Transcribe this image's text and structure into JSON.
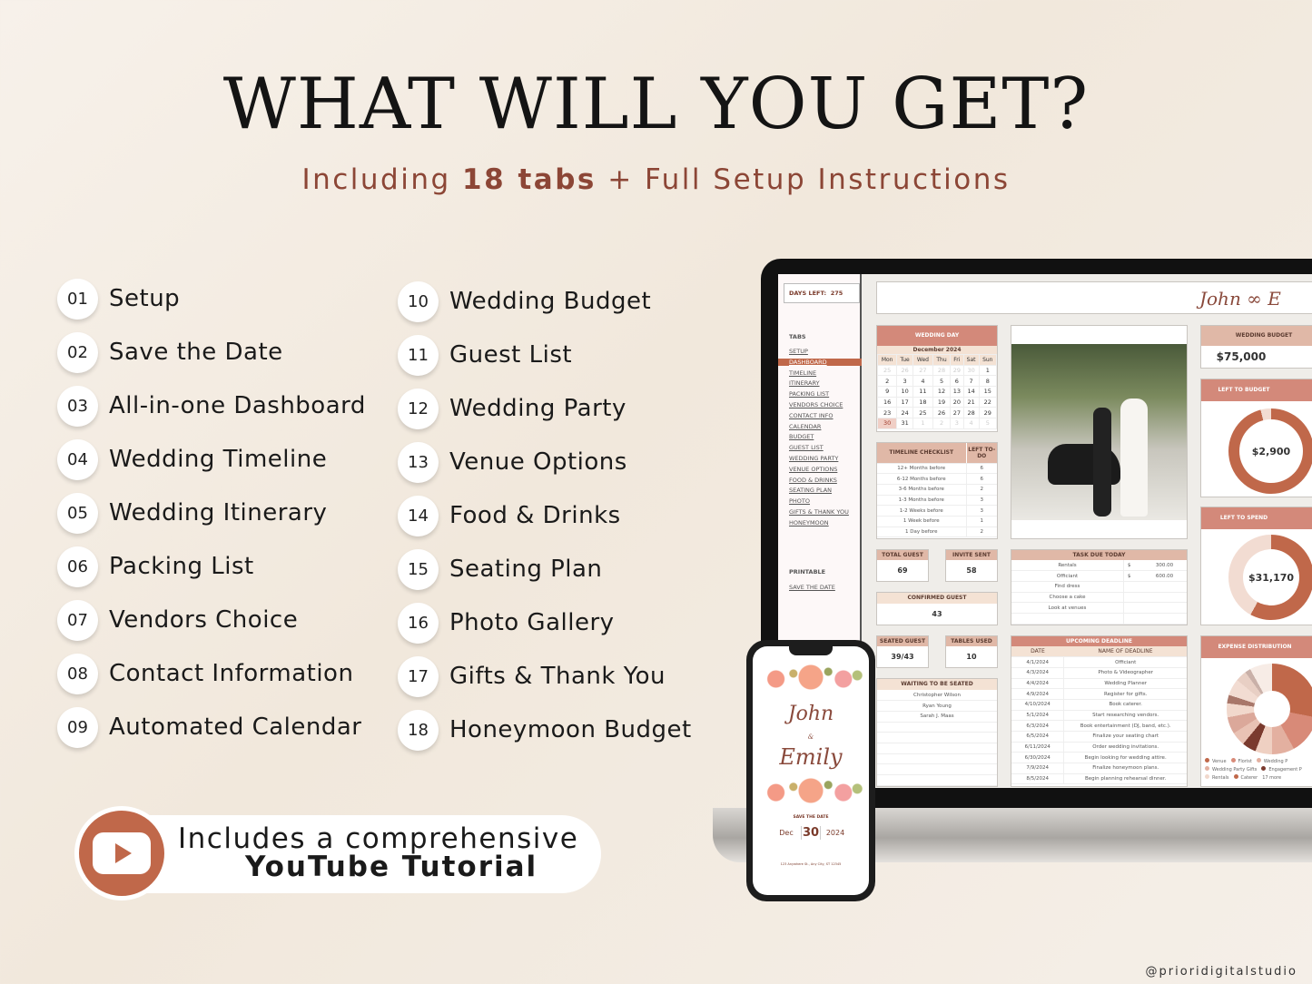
{
  "title": "WHAT WILL YOU GET?",
  "subtitle": {
    "pre": "Including ",
    "bold": "18 tabs",
    "post": " + Full Setup Instructions"
  },
  "features_left": [
    {
      "num": "01",
      "label": "Setup"
    },
    {
      "num": "02",
      "label": "Save the Date"
    },
    {
      "num": "03",
      "label": "All-in-one Dashboard"
    },
    {
      "num": "04",
      "label": "Wedding Timeline"
    },
    {
      "num": "05",
      "label": "Wedding Itinerary"
    },
    {
      "num": "06",
      "label": "Packing List"
    },
    {
      "num": "07",
      "label": "Vendors Choice"
    },
    {
      "num": "08",
      "label": "Contact Information"
    },
    {
      "num": "09",
      "label": "Automated Calendar"
    }
  ],
  "features_right": [
    {
      "num": "10",
      "label": "Wedding Budget"
    },
    {
      "num": "11",
      "label": "Guest List"
    },
    {
      "num": "12",
      "label": "Wedding Party"
    },
    {
      "num": "13",
      "label": "Venue Options"
    },
    {
      "num": "14",
      "label": "Food & Drinks"
    },
    {
      "num": "15",
      "label": "Seating Plan"
    },
    {
      "num": "16",
      "label": "Photo Gallery"
    },
    {
      "num": "17",
      "label": "Gifts & Thank You"
    },
    {
      "num": "18",
      "label": "Honeymoon Budget"
    }
  ],
  "youtube": {
    "line1": "Includes a comprehensive",
    "line2": "YouTube Tutorial",
    "icon": "youtube-play-icon"
  },
  "watermark": "@prioridigitalstudio",
  "colors": {
    "accent": "#c0684a",
    "header": "#d3897a",
    "header_light": "#e0b8a7",
    "header_lighter": "#f4e2d4",
    "subtitle": "#8c4636"
  },
  "sheet": {
    "days_left_label": "DAYS LEFT:",
    "days_left": "275",
    "tabs_label": "TABS",
    "tabs": [
      "SETUP",
      "DASHBOARD",
      "TIMELINE",
      "ITINERARY",
      "PACKING LIST",
      "VENDORS CHOICE",
      "CONTACT INFO",
      "CALENDAR",
      "BUDGET",
      "GUEST LIST",
      "WEDDING PARTY",
      "VENUE OPTIONS",
      "FOOD & DRINKS",
      "SEATING PLAN",
      "PHOTO",
      "GIFTS & THANK YOU",
      "HONEYMOON"
    ],
    "active_tab": "DASHBOARD",
    "printable_label": "PRINTABLE",
    "printable_link": "SAVE THE DATE",
    "header_names": "John  ∞  E",
    "wedding_day": {
      "title": "WEDDING DAY",
      "month": "December 2024",
      "weekdays": [
        "Mon",
        "Tue",
        "Wed",
        "Thu",
        "Fri",
        "Sat",
        "Sun"
      ],
      "weeks": [
        [
          "25",
          "26",
          "27",
          "28",
          "29",
          "30",
          "1"
        ],
        [
          "2",
          "3",
          "4",
          "5",
          "6",
          "7",
          "8"
        ],
        [
          "9",
          "10",
          "11",
          "12",
          "13",
          "14",
          "15"
        ],
        [
          "16",
          "17",
          "18",
          "19",
          "20",
          "21",
          "22"
        ],
        [
          "23",
          "24",
          "25",
          "26",
          "27",
          "28",
          "29"
        ],
        [
          "30",
          "31",
          "1",
          "2",
          "3",
          "4",
          "5"
        ]
      ],
      "selected": "30"
    },
    "timeline": {
      "headers": [
        "TIMELINE CHECKLIST",
        "LEFT TO-DO"
      ],
      "rows": [
        [
          "12+ Months before",
          "6"
        ],
        [
          "6-12 Months before",
          "6"
        ],
        [
          "3-6 Months before",
          "2"
        ],
        [
          "1-3 Months before",
          "3"
        ],
        [
          "1-2 Weeks before",
          "3"
        ],
        [
          "1 Week before",
          "1"
        ],
        [
          "1 Day before",
          "2"
        ]
      ]
    },
    "total_guest": {
      "label": "TOTAL GUEST",
      "value": "69"
    },
    "invite_sent": {
      "label": "INVITE SENT",
      "value": "58"
    },
    "confirmed_guest": {
      "label": "CONFIRMED GUEST",
      "value": "43"
    },
    "seated_guest": {
      "label": "SEATED GUEST",
      "value": "39/43"
    },
    "tables_used": {
      "label": "TABLES USED",
      "value": "10"
    },
    "waiting": {
      "label": "WAITING TO BE SEATED",
      "names": [
        "Christopher Wilson",
        "Ryan Young",
        "Sarah J. Maas"
      ]
    },
    "task_due": {
      "label": "TASK DUE TODAY",
      "rows": [
        [
          "Rentals",
          "$",
          "300.00"
        ],
        [
          "Officiant",
          "$",
          "600.00"
        ],
        [
          "Find dress",
          "",
          ""
        ],
        [
          "Choose a cake",
          "",
          ""
        ],
        [
          "Look at venues",
          "",
          ""
        ]
      ]
    },
    "deadlines": {
      "label": "UPCOMING DEADLINE",
      "headers": [
        "DATE",
        "NAME OF DEADLINE"
      ],
      "rows": [
        [
          "4/1/2024",
          "Officiant"
        ],
        [
          "4/3/2024",
          "Photo & Videographer"
        ],
        [
          "4/4/2024",
          "Wedding Planner"
        ],
        [
          "4/9/2024",
          "Register for gifts."
        ],
        [
          "4/10/2024",
          "Book caterer."
        ],
        [
          "5/1/2024",
          "Start researching vendors."
        ],
        [
          "6/3/2024",
          "Book entertainment (DJ, band, etc.)."
        ],
        [
          "6/5/2024",
          "Finalize your seating chart"
        ],
        [
          "6/11/2024",
          "Order wedding invitations."
        ],
        [
          "6/30/2024",
          "Begin looking for wedding attire."
        ],
        [
          "7/9/2024",
          "Finalize honeymoon plans."
        ],
        [
          "8/5/2024",
          "Begin planning rehearsal dinner."
        ]
      ]
    },
    "wedding_budget": {
      "label": "WEDDING BUDGET",
      "value": "$75,000"
    },
    "left_to_budget": {
      "label": "LEFT TO BUDGET",
      "value": "$2,900",
      "filled_percent": 96
    },
    "left_to_spend": {
      "label": "LEFT TO SPEND",
      "value": "$31,170",
      "filled_percent": 58
    },
    "expense": {
      "label": "EXPENSE DISTRIBUTION",
      "legend": [
        "Venue",
        "Florist",
        "Wedding P",
        "Wedding Party Gifts",
        "Engagement P",
        "Rentals",
        "Caterer",
        "17 more"
      ]
    }
  },
  "phone": {
    "name1": "John",
    "amp": "&",
    "name2": "Emily",
    "save_label": "SAVE THE DATE",
    "month": "Dec",
    "day": "30",
    "year": "2024",
    "address": "123 Anywhere St., Any City, ST 12345"
  }
}
